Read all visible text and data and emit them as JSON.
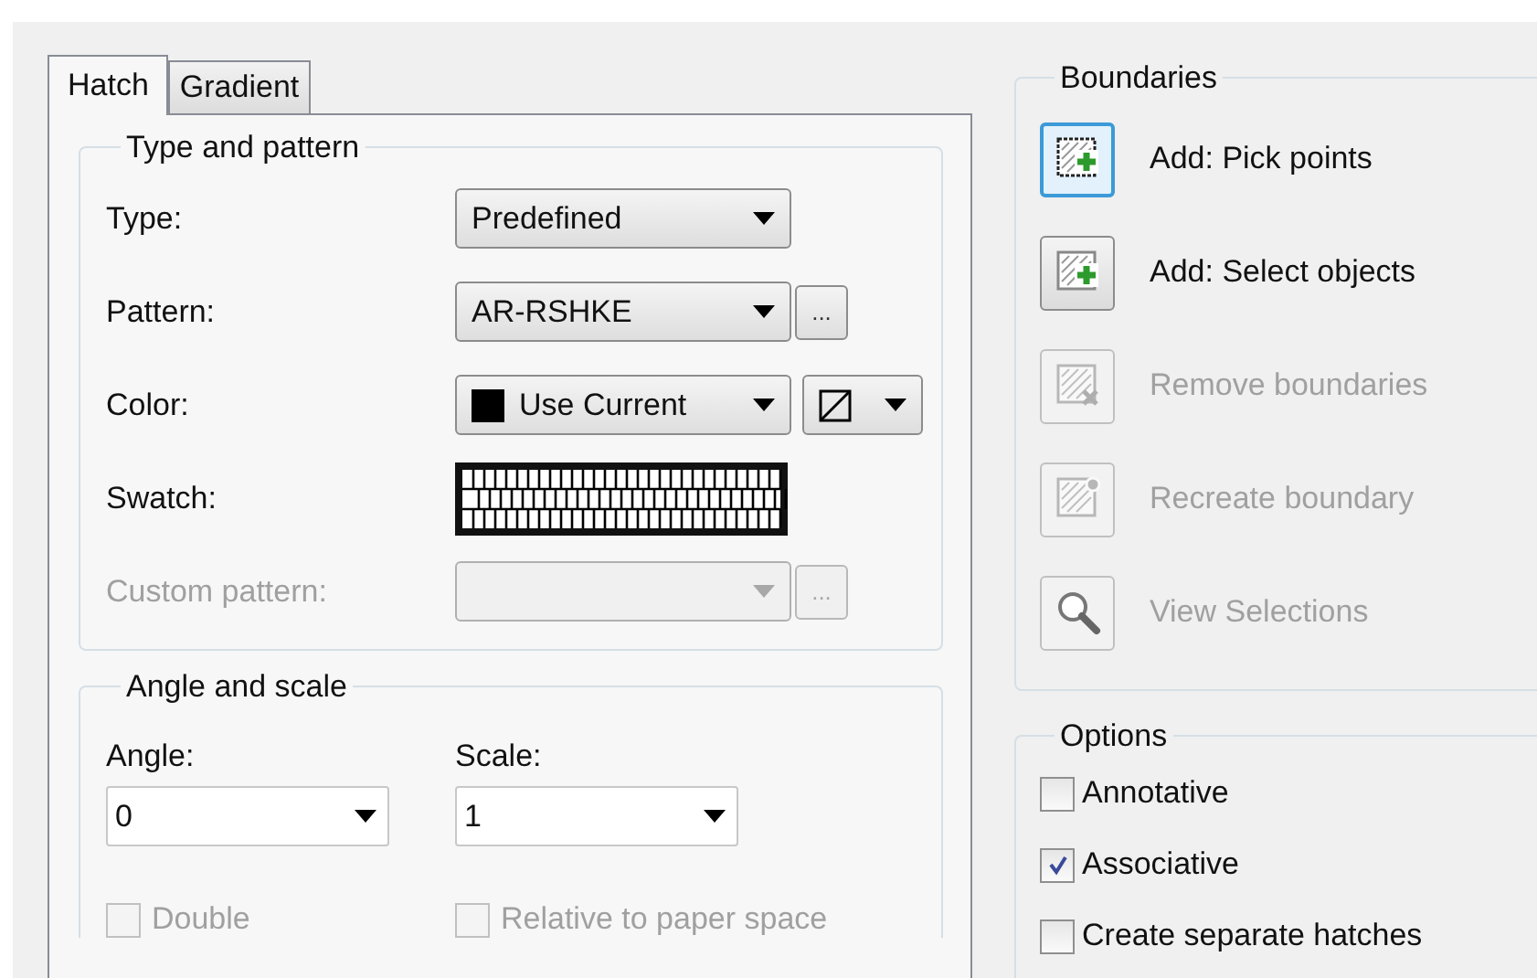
{
  "tabs": [
    {
      "label": "Hatch",
      "selected": true
    },
    {
      "label": "Gradient",
      "selected": false
    }
  ],
  "type_and_pattern": {
    "title": "Type and pattern",
    "fields": [
      {
        "kind": "dropdown",
        "label": "Type:",
        "value": "Predefined",
        "disabled": false
      },
      {
        "kind": "dropdown_browse",
        "label": "Pattern:",
        "value": "AR-RSHKE",
        "browse": "...",
        "disabled": false
      },
      {
        "kind": "color",
        "label": "Color:",
        "value": "Use Current",
        "disabled": false
      },
      {
        "kind": "swatch",
        "label": "Swatch:",
        "disabled": false
      },
      {
        "kind": "dropdown_browse",
        "label": "Custom pattern:",
        "browse": "...",
        "disabled": true
      }
    ]
  },
  "angle_and_scale": {
    "title": "Angle and scale",
    "fields": [
      {
        "label": "Angle:",
        "value": "0"
      },
      {
        "label": "Scale:",
        "value": "1"
      }
    ],
    "checkboxes": [
      {
        "label": "Double",
        "checked": false,
        "disabled": true
      },
      {
        "label": "Relative to paper space",
        "checked": false,
        "disabled": true
      }
    ]
  },
  "boundaries": {
    "title": "Boundaries",
    "buttons": [
      {
        "kind": "pick",
        "label": "Add: Pick points",
        "disabled": false,
        "focused": true
      },
      {
        "kind": "select",
        "label": "Add: Select objects",
        "disabled": false,
        "focused": false
      },
      {
        "kind": "remove",
        "label": "Remove boundaries",
        "disabled": true,
        "focused": false
      },
      {
        "kind": "recreate",
        "label": "Recreate boundary",
        "disabled": true,
        "focused": false
      },
      {
        "kind": "view",
        "label": "View Selections",
        "disabled": true,
        "focused": false
      }
    ]
  },
  "options": {
    "title": "Options",
    "checkboxes": [
      {
        "label": "Annotative",
        "checked": false,
        "disabled": false
      },
      {
        "label": "Associative",
        "checked": true,
        "disabled": false
      },
      {
        "label": "Create separate hatches",
        "checked": false,
        "disabled": false
      }
    ]
  }
}
